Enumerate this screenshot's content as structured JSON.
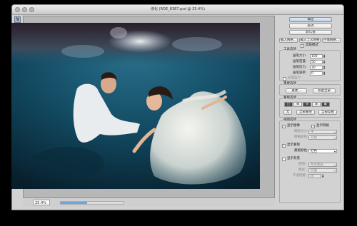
{
  "window": {
    "title": "液化 (ROE_8387.psd @ 25.4%)"
  },
  "toolbar": {
    "tools": [
      {
        "icon": "forward-warp-icon",
        "glyph": "↯"
      },
      {
        "icon": "reconstruct-icon",
        "glyph": "✎"
      },
      {
        "icon": "twirl-icon",
        "glyph": "✺"
      },
      {
        "icon": "pucker-icon",
        "glyph": "✱"
      },
      {
        "icon": "bloat-icon",
        "glyph": "◈"
      },
      {
        "icon": "push-left-icon",
        "glyph": "⇆"
      },
      {
        "icon": "mirror-icon",
        "glyph": "▣"
      },
      {
        "icon": "turbulence-icon",
        "glyph": "≋"
      },
      {
        "icon": "freeze-mask-icon",
        "glyph": "◧"
      },
      {
        "icon": "thaw-mask-icon",
        "glyph": "◨"
      },
      {
        "icon": "hand-icon",
        "glyph": "✋"
      },
      {
        "icon": "zoom-icon",
        "glyph": "⌕"
      }
    ]
  },
  "status": {
    "zoom": "25.4%",
    "progress_fraction": 0.42
  },
  "panel": {
    "ok_label": "确定",
    "cancel_label": "取消",
    "default_label": "默认值",
    "load_mesh_label": "载入网格...",
    "load_last_mesh_label": "载入上次网格",
    "save_mesh_label": "存储网格...",
    "advanced_mode_label": "高级模式",
    "tool_options_label": "工具选项",
    "brush_size_label": "画笔大小:",
    "brush_size_value": "100",
    "brush_density_label": "画笔密度:",
    "brush_density_value": "50",
    "brush_pressure_label": "画笔压力:",
    "brush_pressure_value": "30",
    "brush_rate_label": "画笔速率:",
    "brush_rate_value": "0",
    "stylus_pressure_label": "光笔压力",
    "reconstruct_options_label": "重建选项",
    "reconstruct_button_label": "重建...",
    "restore_all_label": "恢复全部",
    "mask_options_label": "蒙版选项",
    "none_label": "无",
    "mask_all_label": "全部蒙住",
    "invert_all_label": "全部反相",
    "view_options_label": "视图选项",
    "show_mesh_label": "显示网格",
    "show_image_label": "显示图像",
    "mesh_size_label": "网格大小:",
    "mesh_size_value": "中",
    "mesh_color_label": "网格颜色:",
    "mesh_color_value": "灰色",
    "show_mask_label": "显示蒙版",
    "mask_color_label": "蒙版颜色:",
    "mask_color_value": "红色",
    "show_backdrop_label": "显示背景",
    "use_label": "使用:",
    "use_value": "所有图层",
    "mode_label": "模式:",
    "mode_value": "前面",
    "opacity_label": "不透明度:",
    "opacity_value": "50"
  }
}
